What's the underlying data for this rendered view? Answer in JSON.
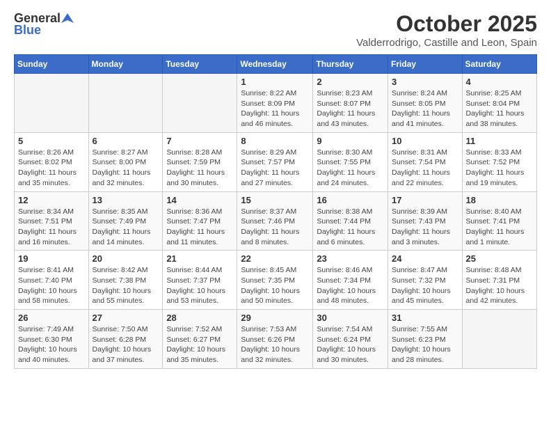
{
  "logo": {
    "general": "General",
    "blue": "Blue"
  },
  "header": {
    "month": "October 2025",
    "location": "Valderrodrigo, Castille and Leon, Spain"
  },
  "weekdays": [
    "Sunday",
    "Monday",
    "Tuesday",
    "Wednesday",
    "Thursday",
    "Friday",
    "Saturday"
  ],
  "weeks": [
    [
      {
        "day": "",
        "info": ""
      },
      {
        "day": "",
        "info": ""
      },
      {
        "day": "",
        "info": ""
      },
      {
        "day": "1",
        "info": "Sunrise: 8:22 AM\nSunset: 8:09 PM\nDaylight: 11 hours and 46 minutes."
      },
      {
        "day": "2",
        "info": "Sunrise: 8:23 AM\nSunset: 8:07 PM\nDaylight: 11 hours and 43 minutes."
      },
      {
        "day": "3",
        "info": "Sunrise: 8:24 AM\nSunset: 8:05 PM\nDaylight: 11 hours and 41 minutes."
      },
      {
        "day": "4",
        "info": "Sunrise: 8:25 AM\nSunset: 8:04 PM\nDaylight: 11 hours and 38 minutes."
      }
    ],
    [
      {
        "day": "5",
        "info": "Sunrise: 8:26 AM\nSunset: 8:02 PM\nDaylight: 11 hours and 35 minutes."
      },
      {
        "day": "6",
        "info": "Sunrise: 8:27 AM\nSunset: 8:00 PM\nDaylight: 11 hours and 32 minutes."
      },
      {
        "day": "7",
        "info": "Sunrise: 8:28 AM\nSunset: 7:59 PM\nDaylight: 11 hours and 30 minutes."
      },
      {
        "day": "8",
        "info": "Sunrise: 8:29 AM\nSunset: 7:57 PM\nDaylight: 11 hours and 27 minutes."
      },
      {
        "day": "9",
        "info": "Sunrise: 8:30 AM\nSunset: 7:55 PM\nDaylight: 11 hours and 24 minutes."
      },
      {
        "day": "10",
        "info": "Sunrise: 8:31 AM\nSunset: 7:54 PM\nDaylight: 11 hours and 22 minutes."
      },
      {
        "day": "11",
        "info": "Sunrise: 8:33 AM\nSunset: 7:52 PM\nDaylight: 11 hours and 19 minutes."
      }
    ],
    [
      {
        "day": "12",
        "info": "Sunrise: 8:34 AM\nSunset: 7:51 PM\nDaylight: 11 hours and 16 minutes."
      },
      {
        "day": "13",
        "info": "Sunrise: 8:35 AM\nSunset: 7:49 PM\nDaylight: 11 hours and 14 minutes."
      },
      {
        "day": "14",
        "info": "Sunrise: 8:36 AM\nSunset: 7:47 PM\nDaylight: 11 hours and 11 minutes."
      },
      {
        "day": "15",
        "info": "Sunrise: 8:37 AM\nSunset: 7:46 PM\nDaylight: 11 hours and 8 minutes."
      },
      {
        "day": "16",
        "info": "Sunrise: 8:38 AM\nSunset: 7:44 PM\nDaylight: 11 hours and 6 minutes."
      },
      {
        "day": "17",
        "info": "Sunrise: 8:39 AM\nSunset: 7:43 PM\nDaylight: 11 hours and 3 minutes."
      },
      {
        "day": "18",
        "info": "Sunrise: 8:40 AM\nSunset: 7:41 PM\nDaylight: 11 hours and 1 minute."
      }
    ],
    [
      {
        "day": "19",
        "info": "Sunrise: 8:41 AM\nSunset: 7:40 PM\nDaylight: 10 hours and 58 minutes."
      },
      {
        "day": "20",
        "info": "Sunrise: 8:42 AM\nSunset: 7:38 PM\nDaylight: 10 hours and 55 minutes."
      },
      {
        "day": "21",
        "info": "Sunrise: 8:44 AM\nSunset: 7:37 PM\nDaylight: 10 hours and 53 minutes."
      },
      {
        "day": "22",
        "info": "Sunrise: 8:45 AM\nSunset: 7:35 PM\nDaylight: 10 hours and 50 minutes."
      },
      {
        "day": "23",
        "info": "Sunrise: 8:46 AM\nSunset: 7:34 PM\nDaylight: 10 hours and 48 minutes."
      },
      {
        "day": "24",
        "info": "Sunrise: 8:47 AM\nSunset: 7:32 PM\nDaylight: 10 hours and 45 minutes."
      },
      {
        "day": "25",
        "info": "Sunrise: 8:48 AM\nSunset: 7:31 PM\nDaylight: 10 hours and 42 minutes."
      }
    ],
    [
      {
        "day": "26",
        "info": "Sunrise: 7:49 AM\nSunset: 6:30 PM\nDaylight: 10 hours and 40 minutes."
      },
      {
        "day": "27",
        "info": "Sunrise: 7:50 AM\nSunset: 6:28 PM\nDaylight: 10 hours and 37 minutes."
      },
      {
        "day": "28",
        "info": "Sunrise: 7:52 AM\nSunset: 6:27 PM\nDaylight: 10 hours and 35 minutes."
      },
      {
        "day": "29",
        "info": "Sunrise: 7:53 AM\nSunset: 6:26 PM\nDaylight: 10 hours and 32 minutes."
      },
      {
        "day": "30",
        "info": "Sunrise: 7:54 AM\nSunset: 6:24 PM\nDaylight: 10 hours and 30 minutes."
      },
      {
        "day": "31",
        "info": "Sunrise: 7:55 AM\nSunset: 6:23 PM\nDaylight: 10 hours and 28 minutes."
      },
      {
        "day": "",
        "info": ""
      }
    ]
  ]
}
